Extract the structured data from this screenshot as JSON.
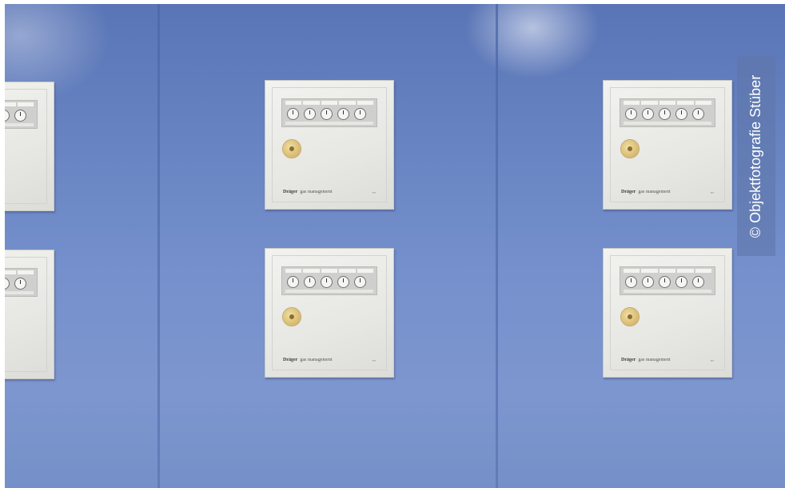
{
  "scene": {
    "wall_color": "#6f89c6",
    "panel_color": "#ecece8",
    "panels": [
      {
        "id": "left-top",
        "brand": "",
        "product": ""
      },
      {
        "id": "left-bottom",
        "brand": "",
        "product": ""
      },
      {
        "id": "center-top",
        "brand": "Dräger",
        "product": "gas management"
      },
      {
        "id": "center-bottom",
        "brand": "Dräger",
        "product": "gas management"
      },
      {
        "id": "right-top",
        "brand": "Dräger",
        "product": "gas management"
      },
      {
        "id": "right-bottom",
        "brand": "Dräger",
        "product": "gas management"
      }
    ]
  },
  "watermark": {
    "text": "© Objektfotografie Stüber"
  }
}
